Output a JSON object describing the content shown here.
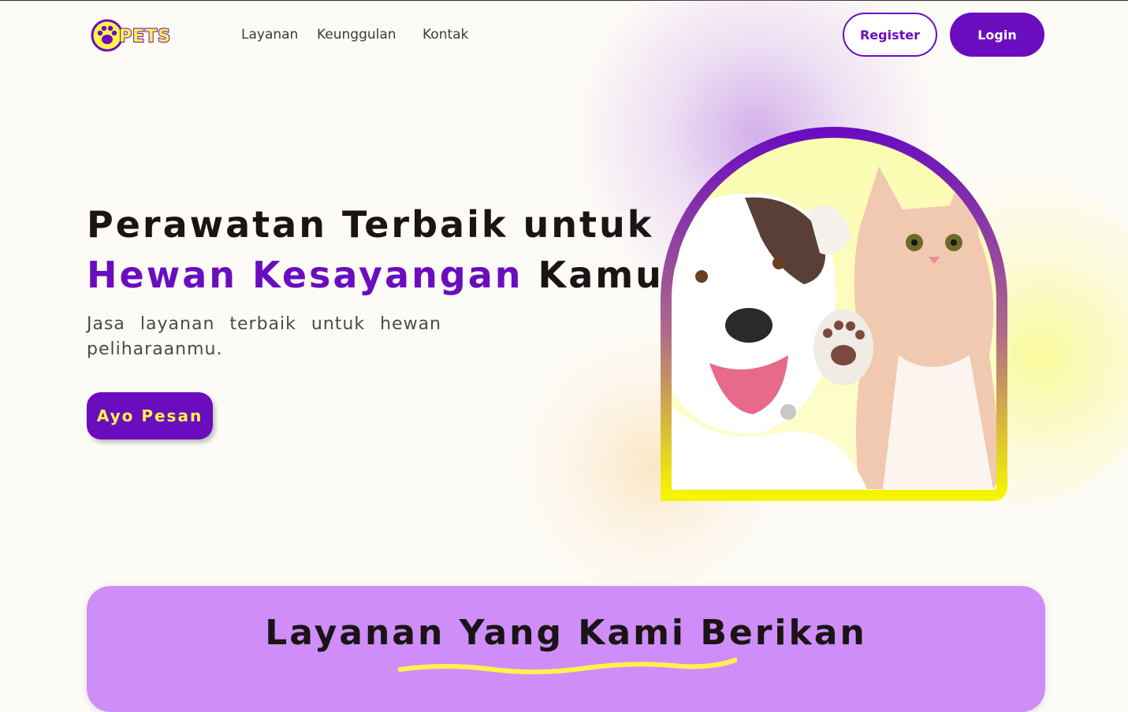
{
  "brand": {
    "logo_text": "PETS"
  },
  "nav": {
    "links": [
      "Layanan",
      "Keunggulan",
      "Kontak"
    ],
    "register_label": "Register",
    "login_label": "Login"
  },
  "hero": {
    "title_line1": "Perawatan Terbaik untuk",
    "title_accent": "Hewan Kesayangan",
    "title_end": "Kamu",
    "subtitle": "Jasa layanan terbaik untuk hewan peliharaanmu.",
    "cta_label": "Ayo Pesan"
  },
  "services": {
    "title": "Layanan Yang Kami Berikan"
  },
  "colors": {
    "brand_purple": "#6a0dbf",
    "accent_yellow": "#fff34a",
    "card_lilac": "#cf8df9",
    "background": "#fdfbf6"
  }
}
